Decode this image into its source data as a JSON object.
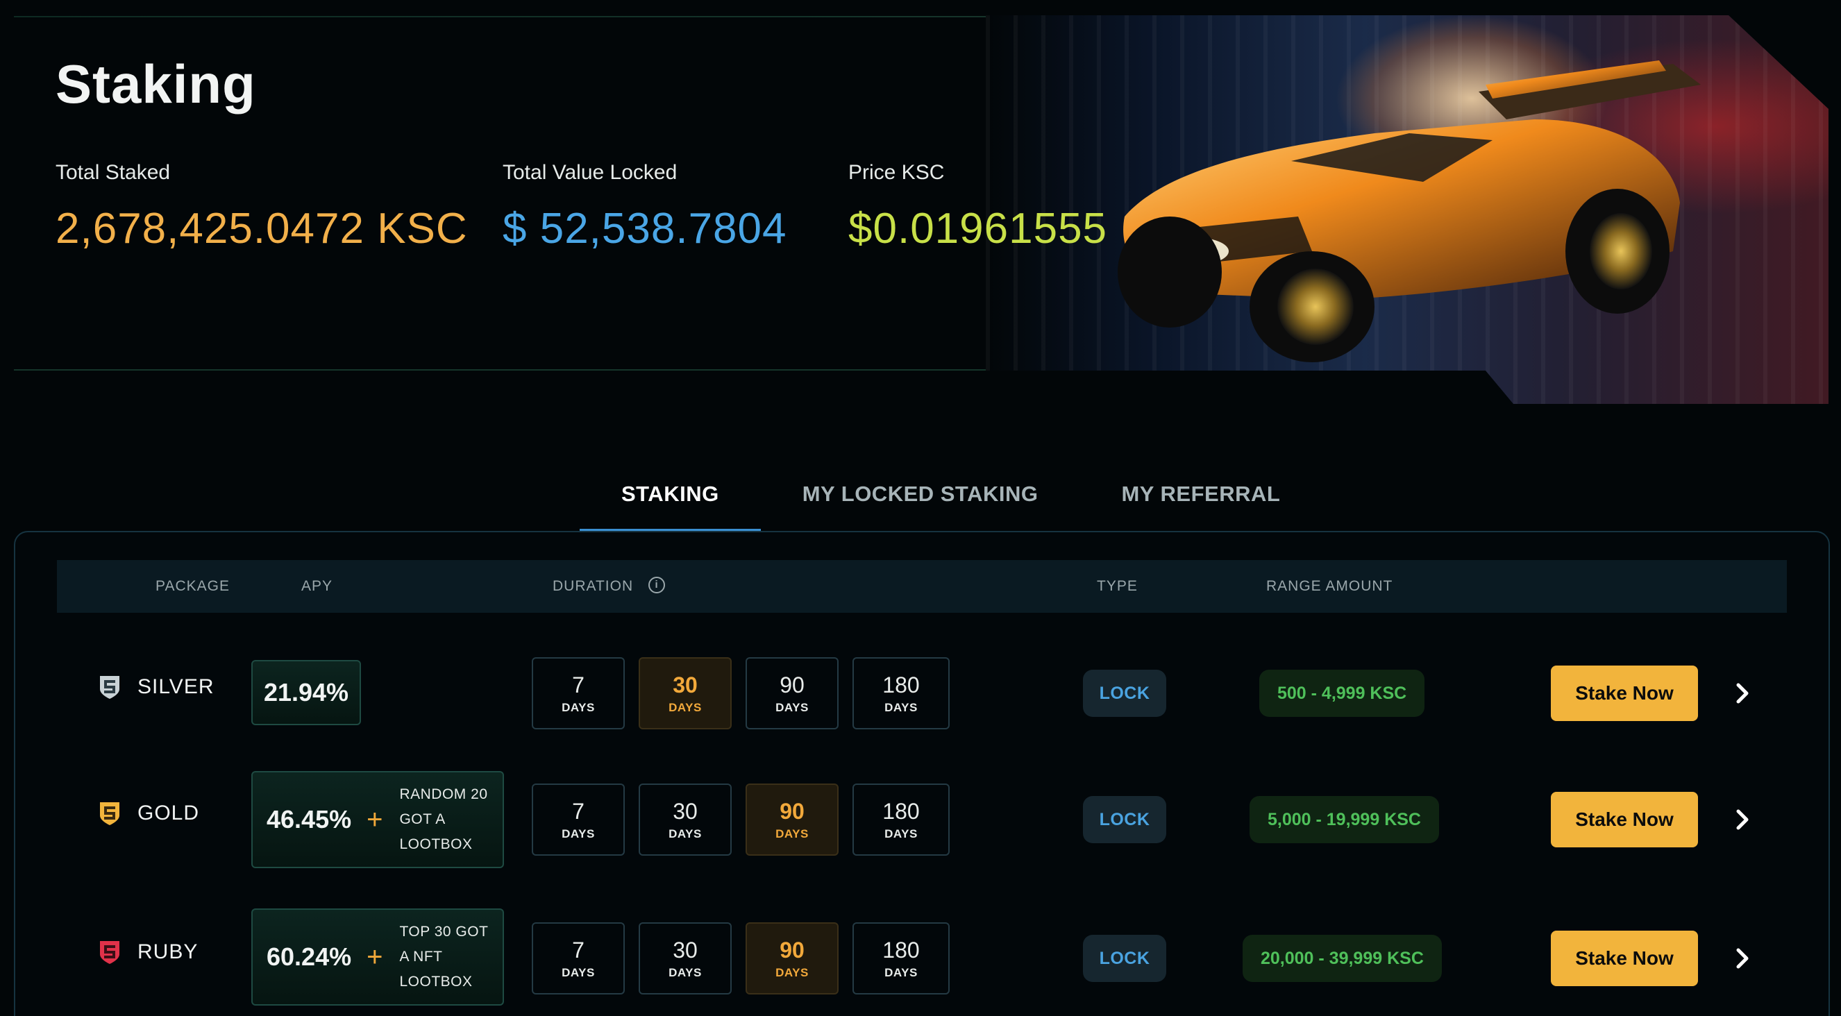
{
  "page": {
    "title": "Staking"
  },
  "stats": [
    {
      "label": "Total Staked",
      "value": "2,678,425.0472 KSC",
      "color": "#f2b04a"
    },
    {
      "label": "Total Value Locked",
      "value": "$ 52,538.7804",
      "color": "#4aa6e6"
    },
    {
      "label": "Price KSC",
      "value": "$0.01961555",
      "color": "#c8e048"
    }
  ],
  "tabs": [
    {
      "label": "STAKING",
      "active": true
    },
    {
      "label": "MY LOCKED STAKING",
      "active": false
    },
    {
      "label": "MY REFERRAL",
      "active": false
    }
  ],
  "table": {
    "headers": {
      "package": "PACKAGE",
      "apy": "APY",
      "duration": "DURATION",
      "type": "TYPE",
      "range": "RANGE AMOUNT"
    },
    "info_icon": "info-circle-icon",
    "rows": [
      {
        "package": "SILVER",
        "badge_color": "#c9d2d6",
        "badge_icon": "shield-s-icon",
        "apy": "21.94%",
        "bonus": [],
        "durations": [
          {
            "n": "7",
            "d": "DAYS"
          },
          {
            "n": "30",
            "d": "DAYS"
          },
          {
            "n": "90",
            "d": "DAYS"
          },
          {
            "n": "180",
            "d": "DAYS"
          }
        ],
        "selected_duration": "30",
        "type": "LOCK",
        "range": "500 - 4,999 KSC",
        "action": "Stake Now"
      },
      {
        "package": "GOLD",
        "badge_color": "#f2b43c",
        "badge_icon": "shield-s-icon",
        "apy": "46.45%",
        "bonus": [
          "RANDOM 20",
          "GOT A",
          "LOOTBOX"
        ],
        "durations": [
          {
            "n": "7",
            "d": "DAYS"
          },
          {
            "n": "30",
            "d": "DAYS"
          },
          {
            "n": "90",
            "d": "DAYS"
          },
          {
            "n": "180",
            "d": "DAYS"
          }
        ],
        "selected_duration": "90",
        "type": "LOCK",
        "range": "5,000 - 19,999 KSC",
        "action": "Stake Now"
      },
      {
        "package": "RUBY",
        "badge_color": "#e0324a",
        "badge_icon": "shield-s-icon",
        "apy": "60.24%",
        "bonus": [
          "TOP 30 GOT",
          "A NFT",
          "LOOTBOX"
        ],
        "durations": [
          {
            "n": "7",
            "d": "DAYS"
          },
          {
            "n": "30",
            "d": "DAYS"
          },
          {
            "n": "90",
            "d": "DAYS"
          },
          {
            "n": "180",
            "d": "DAYS"
          }
        ],
        "selected_duration": "90",
        "type": "LOCK",
        "range": "20,000 - 39,999 KSC",
        "action": "Stake Now"
      }
    ],
    "plus_symbol": "+",
    "chevron_icon": "chevron-right-icon"
  }
}
